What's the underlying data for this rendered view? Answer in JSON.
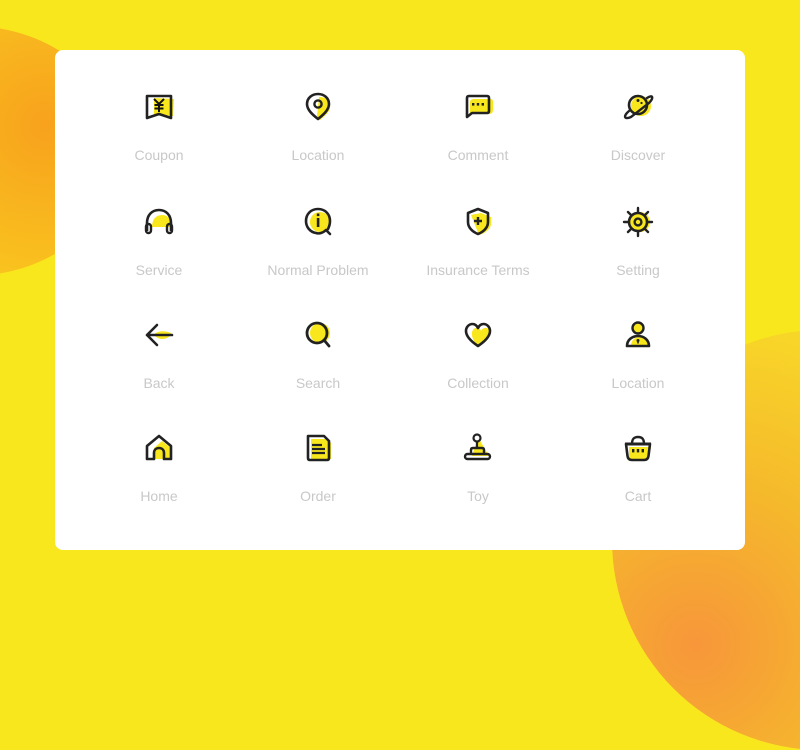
{
  "colors": {
    "background": "#f9e71e",
    "card": "#ffffff",
    "icon_stroke": "#222222",
    "icon_fill": "#f9e71e",
    "label": "#c8c8c8"
  },
  "icons": [
    {
      "label": "Coupon",
      "icon": "coupon-icon"
    },
    {
      "label": "Location",
      "icon": "location-pin-icon"
    },
    {
      "label": "Comment",
      "icon": "comment-icon"
    },
    {
      "label": "Discover",
      "icon": "planet-icon"
    },
    {
      "label": "Service",
      "icon": "headphones-icon"
    },
    {
      "label": "Normal Problem",
      "icon": "info-bubble-icon"
    },
    {
      "label": "Insurance Terms",
      "icon": "shield-plus-icon"
    },
    {
      "label": "Setting",
      "icon": "gear-icon"
    },
    {
      "label": "Back",
      "icon": "arrow-left-icon"
    },
    {
      "label": "Search",
      "icon": "search-icon"
    },
    {
      "label": "Collection",
      "icon": "heart-icon"
    },
    {
      "label": "Location",
      "icon": "user-icon"
    },
    {
      "label": "Home",
      "icon": "home-icon"
    },
    {
      "label": "Order",
      "icon": "document-icon"
    },
    {
      "label": "Toy",
      "icon": "joystick-icon"
    },
    {
      "label": "Cart",
      "icon": "basket-icon"
    }
  ]
}
